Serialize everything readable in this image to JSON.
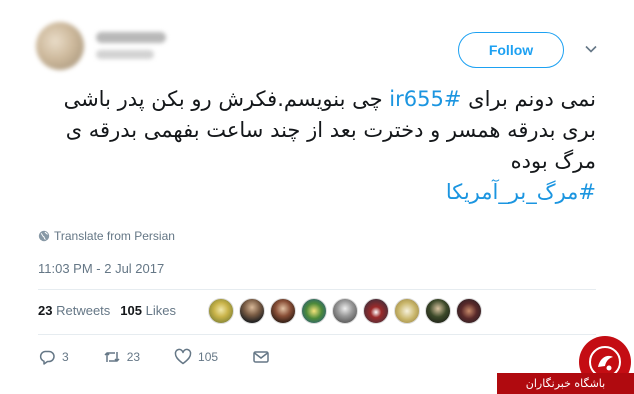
{
  "header": {
    "follow_label": "Follow"
  },
  "tweet": {
    "lines": [
      {
        "before": "نمی دونم برای ",
        "hashtag": "#ir655",
        "after": " چی بنویسم.فکرش رو بکن پدر باشی"
      },
      {
        "before": "بری بدرقه همسر و دخترت بعد از چند ساعت بفهمی بدرقه ی",
        "hashtag": "",
        "after": ""
      },
      {
        "before": "مرگ بوده",
        "hashtag": "",
        "after": ""
      },
      {
        "before": "",
        "hashtag": "#مرگ_بر_آمریکا",
        "after": ""
      }
    ],
    "translate_label": "Translate from Persian",
    "timestamp": "11:03 PM - 2 Jul 2017"
  },
  "stats": {
    "retweets_count": "23",
    "retweets_label": "Retweets",
    "likes_count": "105",
    "likes_label": "Likes"
  },
  "actions": {
    "reply_count": "3",
    "retweet_count": "23",
    "like_count": "105"
  },
  "watermark": {
    "label": "باشگاه خبرنگاران"
  },
  "colors": {
    "accent": "#1da1f2",
    "hashtag": "#1b95e0",
    "muted": "#657786",
    "watermark": "#b00a0f"
  }
}
